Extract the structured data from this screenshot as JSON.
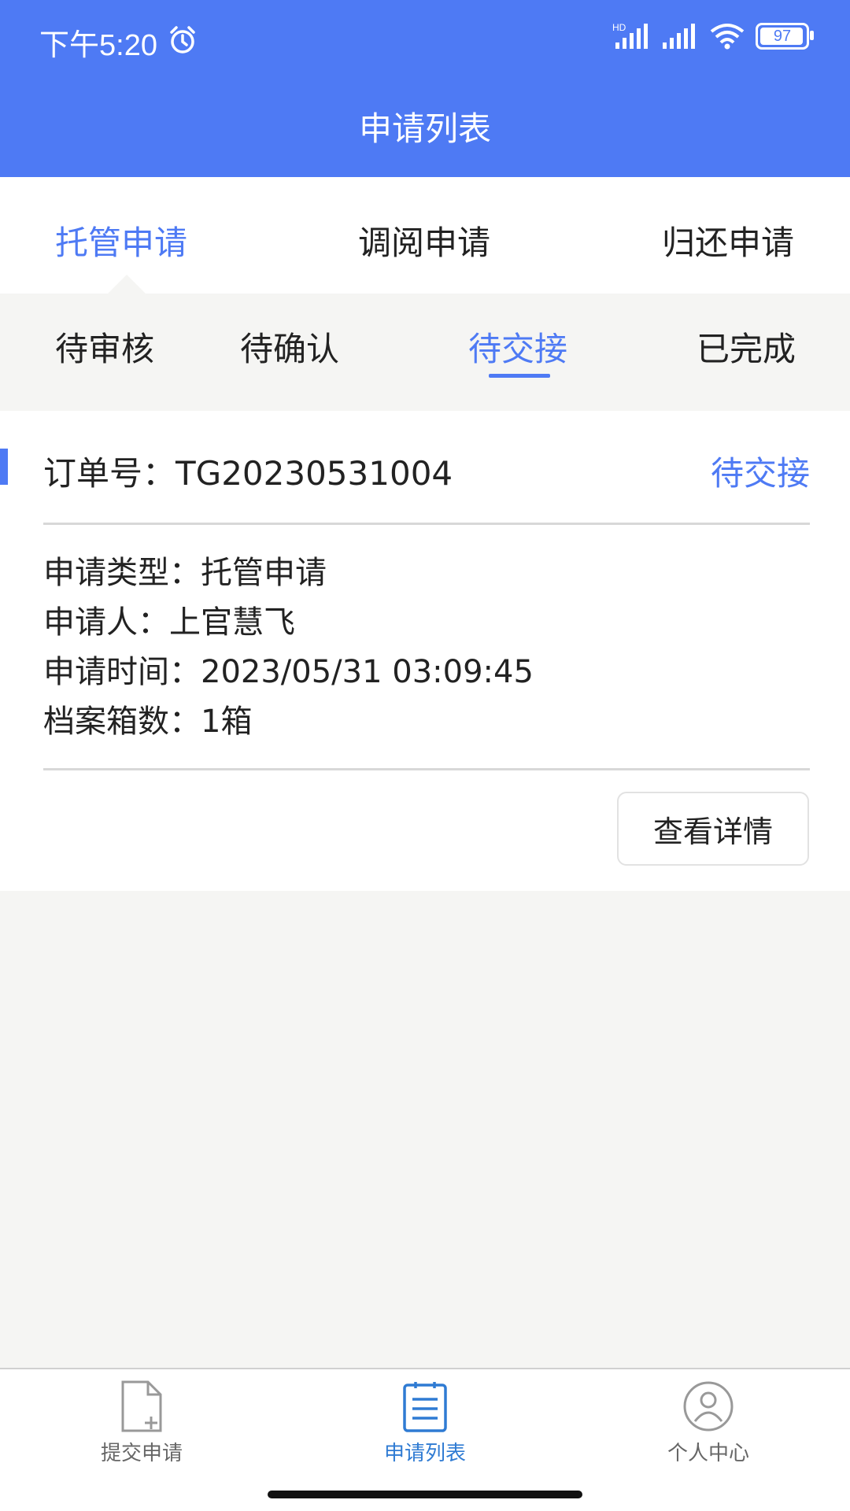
{
  "status_bar": {
    "time": "下午5:20",
    "hd_label": "HD",
    "battery": "97",
    "icons": [
      "alarm-icon",
      "signal-icon",
      "wifi-icon",
      "battery-icon"
    ]
  },
  "header": {
    "title": "申请列表"
  },
  "type_tabs": [
    {
      "label": "托管申请",
      "active": true
    },
    {
      "label": "调阅申请",
      "active": false
    },
    {
      "label": "归还申请",
      "active": false
    }
  ],
  "status_tabs": [
    {
      "label": "待审核",
      "active": false
    },
    {
      "label": "待确认",
      "active": false
    },
    {
      "label": "待交接",
      "active": true
    },
    {
      "label": "已完成",
      "active": false
    }
  ],
  "order": {
    "number_label": "订单号：TG20230531004",
    "status": "待交接",
    "type": "申请类型：托管申请",
    "applicant": "申请人：上官慧飞",
    "time": "申请时间：2023/05/31 03:09:45",
    "boxes": "档案箱数：1箱",
    "detail_button": "查看详情"
  },
  "bottom_nav": [
    {
      "label": "提交申请",
      "icon": "file-add-icon",
      "active": false
    },
    {
      "label": "申请列表",
      "icon": "list-icon",
      "active": true
    },
    {
      "label": "个人中心",
      "icon": "user-icon",
      "active": false
    }
  ],
  "colors": {
    "accent": "#4e7af4",
    "nav_active": "#2f7bd3",
    "background": "#f5f5f3"
  }
}
